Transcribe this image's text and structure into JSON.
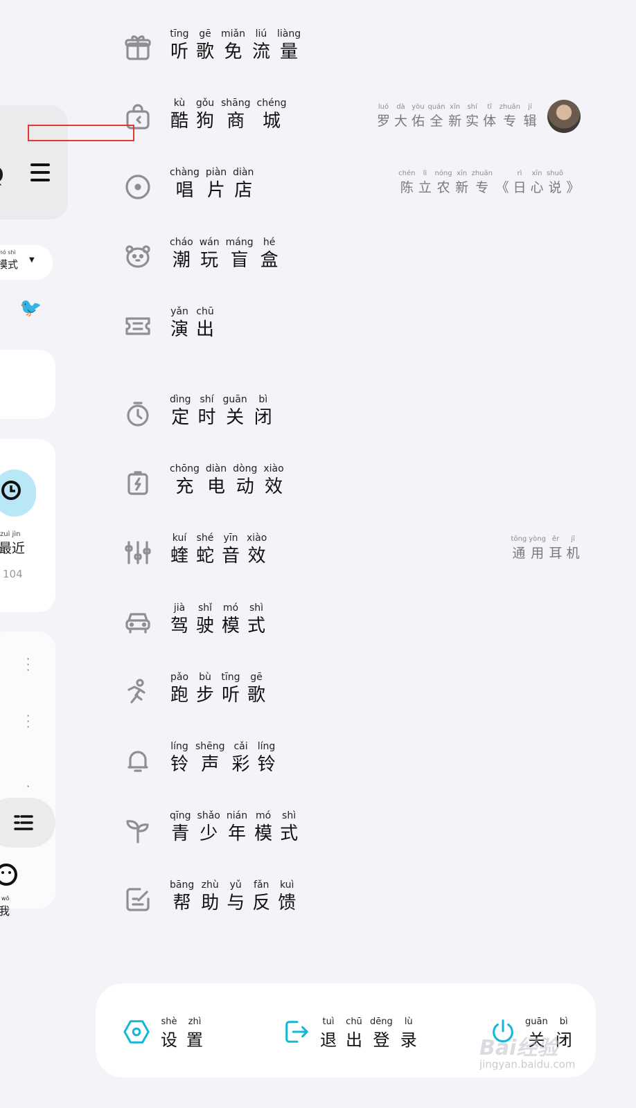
{
  "colors": {
    "icon": "#8e8e95",
    "accent": "#15b6d6",
    "highlight": "#e0392f",
    "background": "#f3f3f8"
  },
  "underlay": {
    "mode": {
      "pinyin": "mó shì",
      "text": "模式"
    },
    "recent": {
      "pinyin": "zuì jìn",
      "text": "最近",
      "count": "104"
    },
    "me": {
      "pinyin": "wǒ",
      "text": "我"
    }
  },
  "menu": [
    {
      "icon": "gift-icon",
      "chars": [
        [
          "tīng",
          "听"
        ],
        [
          "gē",
          "歌"
        ],
        [
          "miǎn",
          "免"
        ],
        [
          "liú",
          "流"
        ],
        [
          "liàng",
          "量"
        ]
      ]
    },
    {
      "icon": "shopping-bag-icon",
      "chars": [
        [
          "kù",
          "酷"
        ],
        [
          "gǒu",
          "狗"
        ],
        [
          "shāng",
          "商"
        ],
        [
          "chéng",
          "城"
        ]
      ],
      "note": {
        "chars": [
          [
            "luó",
            "罗"
          ],
          [
            "dà",
            "大"
          ],
          [
            "yòu",
            "佑"
          ],
          [
            "quán",
            "全"
          ],
          [
            "xīn",
            "新"
          ],
          [
            "shí",
            "实"
          ],
          [
            "tǐ",
            "体"
          ],
          [
            "zhuān",
            "专"
          ],
          [
            "jí",
            "辑"
          ]
        ],
        "avatar": true
      }
    },
    {
      "icon": "vinyl-disc-icon",
      "chars": [
        [
          "chàng",
          "唱"
        ],
        [
          "piàn",
          "片"
        ],
        [
          "diàn",
          "店"
        ]
      ],
      "note": {
        "chars": [
          [
            "chén",
            "陈"
          ],
          [
            "lì",
            "立"
          ],
          [
            "nóng",
            "农"
          ],
          [
            "xīn",
            "新"
          ],
          [
            "zhuān",
            "专"
          ],
          [
            "",
            "《"
          ],
          [
            "rì",
            "日"
          ],
          [
            "xīn",
            "心"
          ],
          [
            "shuō",
            "说"
          ],
          [
            "",
            "》"
          ]
        ]
      }
    },
    {
      "icon": "bear-face-icon",
      "chars": [
        [
          "cháo",
          "潮"
        ],
        [
          "wán",
          "玩"
        ],
        [
          "máng",
          "盲"
        ],
        [
          "hé",
          "盒"
        ]
      ]
    },
    {
      "icon": "ticket-icon",
      "chars": [
        [
          "yǎn",
          "演"
        ],
        [
          "chū",
          "出"
        ]
      ]
    },
    {
      "icon": "timer-icon",
      "chars": [
        [
          "dìng",
          "定"
        ],
        [
          "shí",
          "时"
        ],
        [
          "guān",
          "关"
        ],
        [
          "bì",
          "闭"
        ]
      ]
    },
    {
      "icon": "charging-icon",
      "chars": [
        [
          "chōng",
          "充"
        ],
        [
          "diàn",
          "电"
        ],
        [
          "dòng",
          "动"
        ],
        [
          "xiào",
          "效"
        ]
      ]
    },
    {
      "icon": "equalizer-icon",
      "chars": [
        [
          "kuí",
          "蝰"
        ],
        [
          "shé",
          "蛇"
        ],
        [
          "yīn",
          "音"
        ],
        [
          "xiào",
          "效"
        ]
      ],
      "note": {
        "chars": [
          [
            "tōng",
            "通"
          ],
          [
            "yòng",
            "用"
          ],
          [
            "ěr",
            "耳"
          ],
          [
            "jī",
            "机"
          ]
        ]
      }
    },
    {
      "icon": "car-icon",
      "chars": [
        [
          "jià",
          "驾"
        ],
        [
          "shǐ",
          "驶"
        ],
        [
          "mó",
          "模"
        ],
        [
          "shì",
          "式"
        ]
      ]
    },
    {
      "icon": "running-icon",
      "chars": [
        [
          "pǎo",
          "跑"
        ],
        [
          "bù",
          "步"
        ],
        [
          "tīng",
          "听"
        ],
        [
          "gē",
          "歌"
        ]
      ]
    },
    {
      "icon": "bell-icon",
      "chars": [
        [
          "líng",
          "铃"
        ],
        [
          "shēng",
          "声"
        ],
        [
          "cǎi",
          "彩"
        ],
        [
          "líng",
          "铃"
        ]
      ]
    },
    {
      "icon": "sprout-icon",
      "chars": [
        [
          "qīng",
          "青"
        ],
        [
          "shǎo",
          "少"
        ],
        [
          "nián",
          "年"
        ],
        [
          "mó",
          "模"
        ],
        [
          "shì",
          "式"
        ]
      ]
    },
    {
      "icon": "feedback-edit-icon",
      "chars": [
        [
          "bāng",
          "帮"
        ],
        [
          "zhù",
          "助"
        ],
        [
          "yǔ",
          "与"
        ],
        [
          "fǎn",
          "反"
        ],
        [
          "kuì",
          "馈"
        ]
      ]
    }
  ],
  "bottom": [
    {
      "icon": "settings-icon",
      "chars": [
        [
          "shè",
          "设"
        ],
        [
          "zhì",
          "置"
        ]
      ]
    },
    {
      "icon": "logout-icon",
      "chars": [
        [
          "tuì",
          "退"
        ],
        [
          "chū",
          "出"
        ],
        [
          "dēng",
          "登"
        ],
        [
          "lù",
          "录"
        ]
      ]
    },
    {
      "icon": "power-icon",
      "chars": [
        [
          "guān",
          "关"
        ],
        [
          "bì",
          "闭"
        ]
      ]
    }
  ],
  "watermark": {
    "text": "Bai经验",
    "sub": "jingyan.baidu.com"
  }
}
